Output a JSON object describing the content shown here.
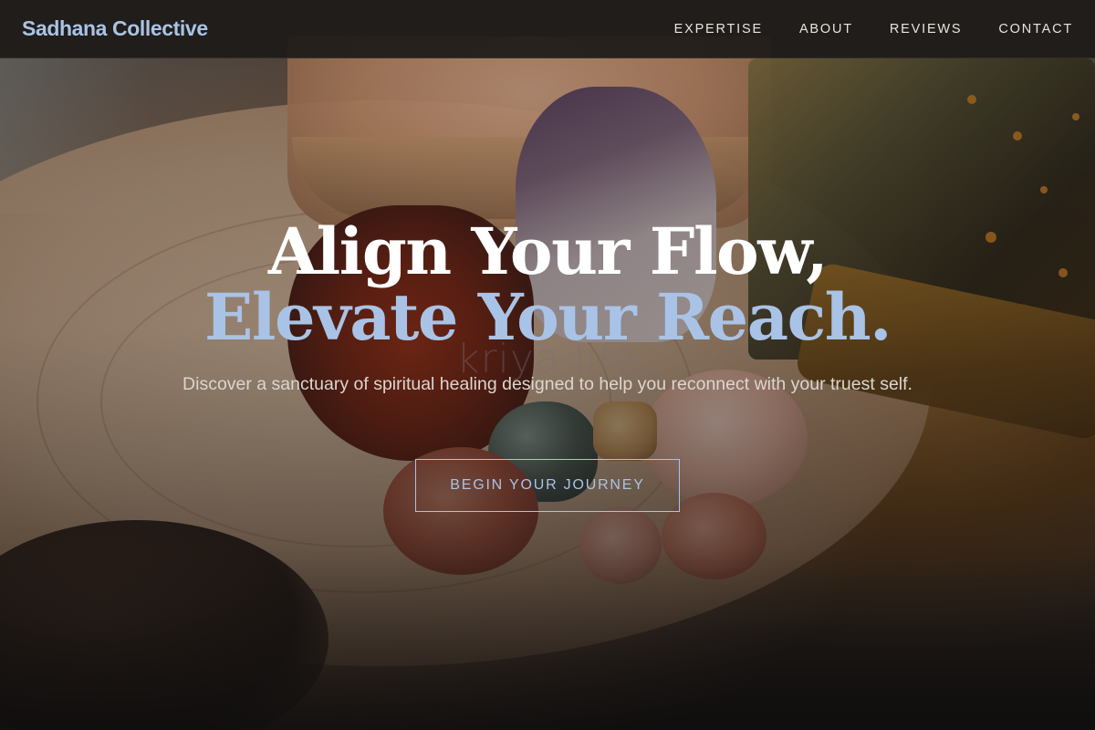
{
  "brand": {
    "name": "Sadhana Collective"
  },
  "nav": {
    "items": [
      {
        "label": "EXPERTISE"
      },
      {
        "label": "ABOUT"
      },
      {
        "label": "REVIEWS"
      },
      {
        "label": "CONTACT"
      }
    ]
  },
  "hero": {
    "title_line1": "Align Your Flow,",
    "title_line2": "Elevate Your Reach.",
    "watermark": "kriya life",
    "subtitle": "Discover a sanctuary of spiritual healing designed to help you reconnect with your truest self.",
    "cta_label": "BEGIN YOUR JOURNEY"
  },
  "colors": {
    "accent": "#a9c3e6",
    "navbar_bg": "#1c1a18",
    "text_light": "#e8e4df"
  }
}
